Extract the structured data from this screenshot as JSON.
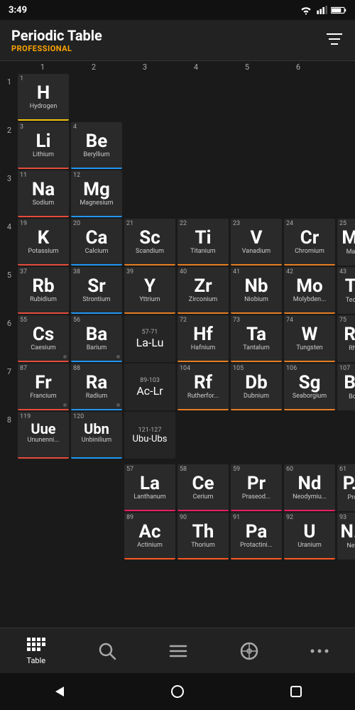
{
  "status": {
    "time": "3:49"
  },
  "header": {
    "title": "Periodic Table",
    "subtitle": "PROFESSIONAL"
  },
  "filter_icon": "≡",
  "col_headers": [
    "1",
    "2",
    "3",
    "4",
    "5",
    "6"
  ],
  "row_labels": [
    "1",
    "2",
    "3",
    "4",
    "5",
    "6",
    "7",
    "8"
  ],
  "elements": {
    "row1": [
      {
        "num": "1",
        "sym": "H",
        "name": "Hydrogen",
        "cat": "hydrogen",
        "col": 1
      }
    ],
    "row2": [
      {
        "num": "3",
        "sym": "Li",
        "name": "Lithium",
        "cat": "alkali",
        "col": 1
      },
      {
        "num": "4",
        "sym": "Be",
        "name": "Beryllium",
        "cat": "alkaline",
        "col": 2
      }
    ],
    "row3": [
      {
        "num": "11",
        "sym": "Na",
        "name": "Sodium",
        "cat": "alkali",
        "col": 1
      },
      {
        "num": "12",
        "sym": "Mg",
        "name": "Magnesium",
        "cat": "alkaline",
        "col": 2
      }
    ],
    "row4": [
      {
        "num": "19",
        "sym": "K",
        "name": "Potassium",
        "cat": "alkali",
        "col": 1
      },
      {
        "num": "20",
        "sym": "Ca",
        "name": "Calcium",
        "cat": "alkaline",
        "col": 2
      },
      {
        "num": "21",
        "sym": "Sc",
        "name": "Scandium",
        "cat": "transition",
        "col": 3
      },
      {
        "num": "22",
        "sym": "Ti",
        "name": "Titanium",
        "cat": "transition",
        "col": 4
      },
      {
        "num": "23",
        "sym": "V",
        "name": "Vanadium",
        "cat": "transition",
        "col": 5
      },
      {
        "num": "24",
        "sym": "Cr",
        "name": "Chromium",
        "cat": "transition",
        "col": 6
      },
      {
        "num": "25",
        "sym": "Mn",
        "name": "Man...",
        "cat": "transition",
        "col": 7,
        "partial": true
      }
    ],
    "row5": [
      {
        "num": "37",
        "sym": "Rb",
        "name": "Rubidium",
        "cat": "alkali",
        "col": 1
      },
      {
        "num": "38",
        "sym": "Sr",
        "name": "Strontium",
        "cat": "alkaline",
        "col": 2
      },
      {
        "num": "39",
        "sym": "Y",
        "name": "Yttrium",
        "cat": "transition",
        "col": 3
      },
      {
        "num": "40",
        "sym": "Zr",
        "name": "Zirconium",
        "cat": "transition",
        "col": 4
      },
      {
        "num": "41",
        "sym": "Nb",
        "name": "Niobium",
        "cat": "transition",
        "col": 5
      },
      {
        "num": "42",
        "sym": "Mo",
        "name": "Molybden...",
        "cat": "transition",
        "col": 6
      },
      {
        "num": "43",
        "sym": "Tc",
        "name": "Tech...",
        "cat": "transition",
        "col": 7,
        "partial": true
      }
    ],
    "row6": [
      {
        "num": "55",
        "sym": "Cs",
        "name": "Caesium",
        "cat": "alkali",
        "col": 1,
        "dot": true
      },
      {
        "num": "56",
        "sym": "Ba",
        "name": "Barium",
        "cat": "alkaline",
        "col": 2,
        "dot": true
      },
      {
        "num": "57-71",
        "sym": "La-Lu",
        "name": "",
        "cat": "range",
        "col": 3
      },
      {
        "num": "72",
        "sym": "Hf",
        "name": "Hafnium",
        "cat": "transition",
        "col": 4
      },
      {
        "num": "73",
        "sym": "Ta",
        "name": "Tantalum",
        "cat": "transition",
        "col": 5
      },
      {
        "num": "74",
        "sym": "W",
        "name": "Tungsten",
        "cat": "transition",
        "col": 6
      },
      {
        "num": "75",
        "sym": "Rh",
        "name": "Rh...",
        "cat": "transition",
        "col": 7,
        "partial": true
      }
    ],
    "row7": [
      {
        "num": "87",
        "sym": "Fr",
        "name": "Francium",
        "cat": "alkali",
        "col": 1,
        "dot": true
      },
      {
        "num": "88",
        "sym": "Ra",
        "name": "Radium",
        "cat": "alkaline",
        "col": 2,
        "dot": true
      },
      {
        "num": "89-103",
        "sym": "Ac-Lr",
        "name": "",
        "cat": "range",
        "col": 3
      },
      {
        "num": "104",
        "sym": "Rf",
        "name": "Rutherfor...",
        "cat": "transition",
        "col": 4
      },
      {
        "num": "105",
        "sym": "Db",
        "name": "Dubnium",
        "cat": "transition",
        "col": 5
      },
      {
        "num": "106",
        "sym": "Sg",
        "name": "Seaborgium",
        "cat": "transition",
        "col": 6
      },
      {
        "num": "107",
        "sym": "B...",
        "name": "Bo...",
        "cat": "transition",
        "col": 7,
        "partial": true
      }
    ],
    "row8": [
      {
        "num": "119",
        "sym": "Uue",
        "name": "Ununenni...",
        "cat": "alkali",
        "col": 1
      },
      {
        "num": "120",
        "sym": "Ubn",
        "name": "Unbinilium",
        "cat": "alkaline",
        "col": 2
      },
      {
        "num": "121-127",
        "sym": "Ubu-Ubs",
        "name": "",
        "cat": "range",
        "col": 3
      }
    ],
    "lanthanides": [
      {
        "num": "57",
        "sym": "La",
        "name": "Lanthanum",
        "cat": "lanthanide"
      },
      {
        "num": "58",
        "sym": "Ce",
        "name": "Cerium",
        "cat": "lanthanide"
      },
      {
        "num": "59",
        "sym": "Pr",
        "name": "Praseod...",
        "cat": "lanthanide"
      },
      {
        "num": "60",
        "sym": "Nd",
        "name": "Neodymiu...",
        "cat": "lanthanide"
      },
      {
        "num": "61",
        "sym": "P...",
        "name": "Pro...",
        "cat": "lanthanide",
        "partial": true
      }
    ],
    "actinides": [
      {
        "num": "89",
        "sym": "Ac",
        "name": "Actinium",
        "cat": "actinide"
      },
      {
        "num": "90",
        "sym": "Th",
        "name": "Thorium",
        "cat": "actinide"
      },
      {
        "num": "91",
        "sym": "Pa",
        "name": "Protactini...",
        "cat": "actinide"
      },
      {
        "num": "92",
        "sym": "U",
        "name": "Uranium",
        "cat": "actinide"
      },
      {
        "num": "93",
        "sym": "N...",
        "name": "Nep...",
        "cat": "actinide",
        "partial": true
      }
    ]
  },
  "bottom_nav": {
    "items": [
      {
        "id": "table",
        "label": "Table",
        "active": true
      },
      {
        "id": "search",
        "label": ""
      },
      {
        "id": "list",
        "label": ""
      },
      {
        "id": "quiz",
        "label": ""
      },
      {
        "id": "more",
        "label": ""
      }
    ]
  }
}
